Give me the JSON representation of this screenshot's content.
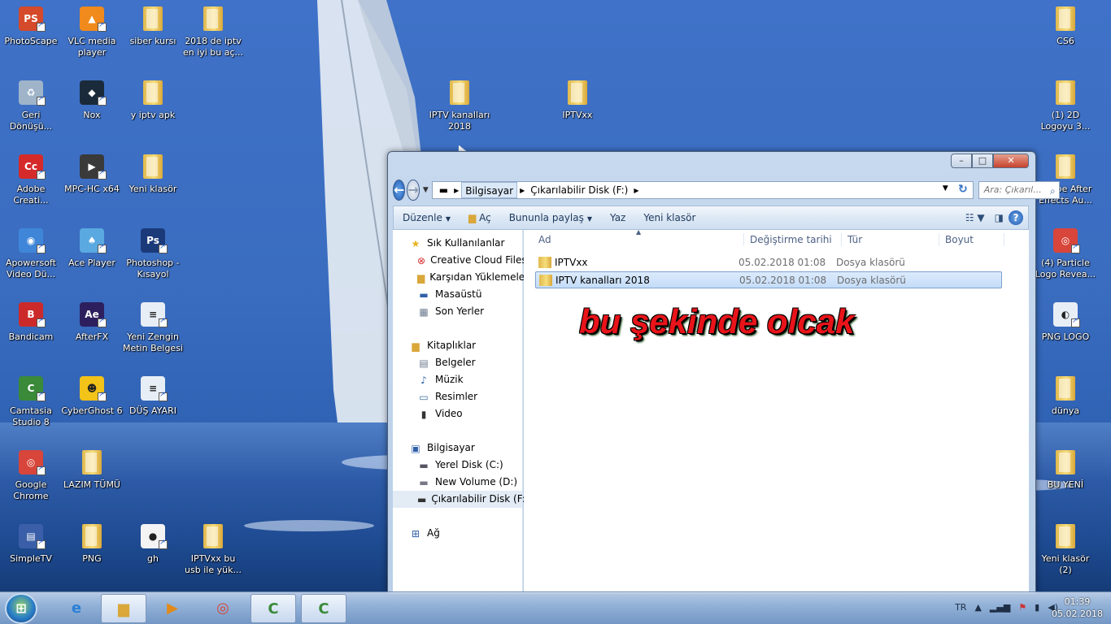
{
  "desktop": {
    "icons": [
      {
        "id": "photoscape",
        "label": "PhotoScape",
        "kind": "app",
        "color": "#d44a2a",
        "glyph": "PS"
      },
      {
        "id": "vlc",
        "label": "VLC media player",
        "kind": "app",
        "color": "#f08a1c",
        "glyph": "▲"
      },
      {
        "id": "siber",
        "label": "siber kursı",
        "kind": "folder"
      },
      {
        "id": "iptv2018",
        "label": "2018 de iptv en iyi bu aç...",
        "kind": "folder"
      },
      {
        "id": "gerid",
        "label": "Geri Dönüşü...",
        "kind": "app",
        "color": "#9fb4c9",
        "glyph": "♻"
      },
      {
        "id": "nox",
        "label": "Nox",
        "kind": "app",
        "color": "#1a2a3a",
        "glyph": "◆"
      },
      {
        "id": "yiptv",
        "label": "y iptv apk",
        "kind": "folder"
      },
      {
        "id": "adobe",
        "label": "Adobe Creati...",
        "kind": "app",
        "color": "#d52a2a",
        "glyph": "Cc"
      },
      {
        "id": "mpc",
        "label": "MPC-HC x64",
        "kind": "app",
        "color": "#3a3a3a",
        "glyph": "▶"
      },
      {
        "id": "yeniklasor",
        "label": "Yeni klasör",
        "kind": "folder"
      },
      {
        "id": "apower",
        "label": "Apowersoft Video Dü...",
        "kind": "app",
        "color": "#3f86d9",
        "glyph": "◉"
      },
      {
        "id": "ace",
        "label": "Ace Player",
        "kind": "app",
        "color": "#5aa9e0",
        "glyph": "♠"
      },
      {
        "id": "photoshop",
        "label": "Photoshop - Kısayol",
        "kind": "app",
        "color": "#1b3a7a",
        "glyph": "Ps"
      },
      {
        "id": "bandicam",
        "label": "Bandicam",
        "kind": "app",
        "color": "#cc2a2a",
        "glyph": "B"
      },
      {
        "id": "afterfx",
        "label": "AfterFX",
        "kind": "app",
        "color": "#2d1f5e",
        "glyph": "Ae"
      },
      {
        "id": "yenizengin",
        "label": "Yeni Zengin Metin Belgesi",
        "kind": "app",
        "color": "#e8eef6",
        "glyph": "≡"
      },
      {
        "id": "camtasia",
        "label": "Camtasia Studio 8",
        "kind": "app",
        "color": "#3a8a3a",
        "glyph": "C"
      },
      {
        "id": "cyberghost",
        "label": "CyberGhost 6",
        "kind": "app",
        "color": "#f2c318",
        "glyph": "☻"
      },
      {
        "id": "dusayari",
        "label": "DÜŞ AYARI",
        "kind": "app",
        "color": "#e8eef6",
        "glyph": "≡"
      },
      {
        "id": "chrome",
        "label": "Google Chrome",
        "kind": "app",
        "color": "#d8453a",
        "glyph": "◎"
      },
      {
        "id": "lazim",
        "label": "LAZIM TÜMÜ",
        "kind": "folder"
      },
      {
        "id": "simpletv",
        "label": "SimpleTV",
        "kind": "app",
        "color": "#3a5fa8",
        "glyph": "▤"
      },
      {
        "id": "png",
        "label": "PNG",
        "kind": "folder"
      },
      {
        "id": "gh",
        "label": "gh",
        "kind": "app",
        "color": "#f4f4f4",
        "glyph": "●"
      },
      {
        "id": "iptvxxbu",
        "label": "IPTVxx bu usb ile yük...",
        "kind": "folder"
      },
      {
        "id": "iptvkanal2018",
        "label": "IPTV kanalları 2018",
        "kind": "folder"
      },
      {
        "id": "iptvxx",
        "label": "IPTVxx",
        "kind": "folder"
      },
      {
        "id": "cs6",
        "label": "CS6",
        "kind": "folder"
      },
      {
        "id": "2dlogo",
        "label": "(1) 2D Logoyu 3...",
        "kind": "folder"
      },
      {
        "id": "aeauto",
        "label": "Adobe After Effects Au...",
        "kind": "folder"
      },
      {
        "id": "particle",
        "label": "(4) Particle Logo Revea...",
        "kind": "app",
        "color": "#d8453a",
        "glyph": "◎"
      },
      {
        "id": "pnglogo",
        "label": "PNG LOGO",
        "kind": "app",
        "color": "#e8eef6",
        "glyph": "◐"
      },
      {
        "id": "dunya",
        "label": "dünya",
        "kind": "folder"
      },
      {
        "id": "buyeni",
        "label": "BU YENİ",
        "kind": "folder"
      },
      {
        "id": "yeniklasor2",
        "label": "Yeni klasör (2)",
        "kind": "folder"
      }
    ]
  },
  "explorer": {
    "address": {
      "segments": [
        "Bilgisayar",
        "Çıkarılabilir Disk (F:)"
      ]
    },
    "search_placeholder": "Ara: Çıkarıl...",
    "toolbar": {
      "organize": "Düzenle",
      "open": "Aç",
      "share": "Bununla paylaş",
      "burn": "Yaz",
      "new_folder": "Yeni klasör"
    },
    "nav": {
      "favorites_title": "Sık Kullanılanlar",
      "favorites": [
        "Creative Cloud Files",
        "Karşıdan Yüklemeler",
        "Masaüstü",
        "Son Yerler"
      ],
      "libraries_title": "Kitaplıklar",
      "libraries": [
        "Belgeler",
        "Müzik",
        "Resimler",
        "Video"
      ],
      "computer_title": "Bilgisayar",
      "drives": [
        "Yerel Disk (C:)",
        "New Volume (D:)",
        "Çıkarılabilir Disk (F:)"
      ],
      "network": "Ağ"
    },
    "columns": {
      "name": "Ad",
      "date": "Değiştirme tarihi",
      "type": "Tür",
      "size": "Boyut"
    },
    "rows": [
      {
        "name": "IPTVxx",
        "date": "05.02.2018 01:08",
        "type": "Dosya klasörü",
        "size": ""
      },
      {
        "name": "IPTV kanalları  2018",
        "date": "05.02.2018 01:08",
        "type": "Dosya klasörü",
        "size": ""
      }
    ]
  },
  "overlay_caption": "bu şekinde olcak",
  "taskbar": {
    "lang": "TR",
    "time": "01:39",
    "date": "05.02.2018"
  }
}
